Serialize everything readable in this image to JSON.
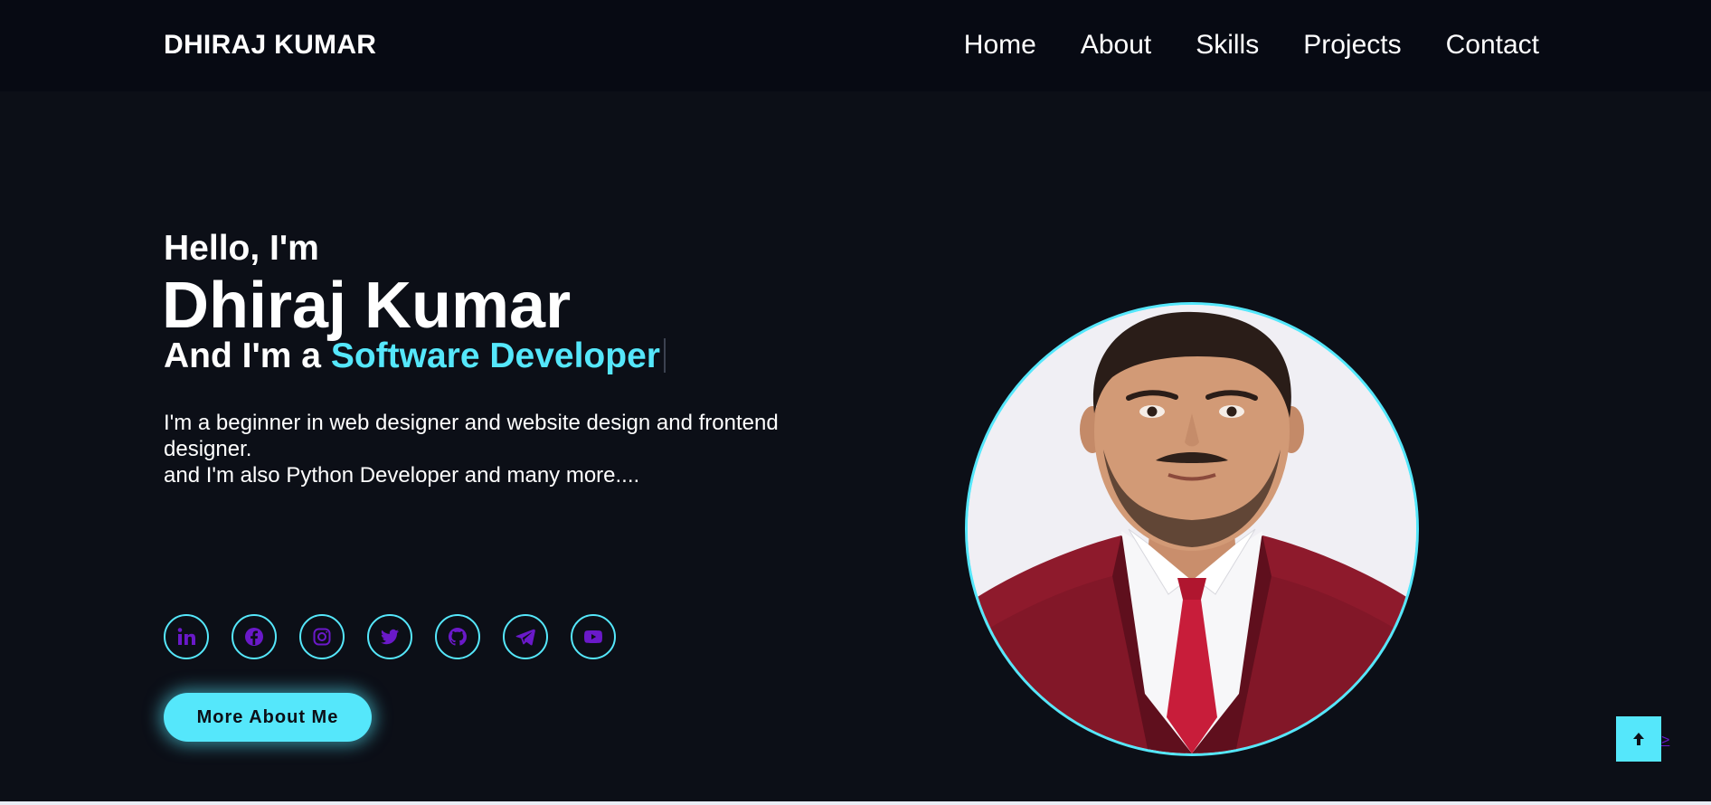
{
  "navbar": {
    "logo": "DHIRAJ KUMAR",
    "links": [
      "Home",
      "About",
      "Skills",
      "Projects",
      "Contact"
    ]
  },
  "hero": {
    "greeting": "Hello, I'm",
    "name": "Dhiraj Kumar",
    "role_prefix": "And I'm a",
    "role_highlight": "Software Developer",
    "description_line1": "I'm a beginner in web designer and website design and frontend designer.",
    "description_line2": "and I'm also Python Developer and many more....",
    "cta_label": "More About Me"
  },
  "socials": [
    {
      "icon": "linkedin-icon"
    },
    {
      "icon": "facebook-icon"
    },
    {
      "icon": "instagram-icon"
    },
    {
      "icon": "twitter-icon"
    },
    {
      "icon": "github-icon"
    },
    {
      "icon": "telegram-icon"
    },
    {
      "icon": "youtube-icon"
    }
  ],
  "scroll_top": {
    "icon": "arrow-up-icon",
    "link_text": ">"
  },
  "colors": {
    "accent": "#55e7fb",
    "background": "#0c0f17",
    "navbar": "#070a13",
    "icon": "#6a19c9",
    "jacket": "#8e1a2c",
    "tie": "#c81d3a"
  }
}
